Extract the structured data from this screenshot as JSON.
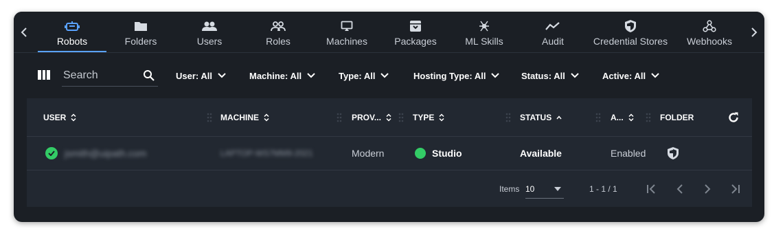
{
  "tabs": [
    {
      "label": "Robots",
      "icon": "robot-icon",
      "active": true
    },
    {
      "label": "Folders",
      "icon": "folder-icon"
    },
    {
      "label": "Users",
      "icon": "users-icon"
    },
    {
      "label": "Roles",
      "icon": "roles-icon"
    },
    {
      "label": "Machines",
      "icon": "monitor-icon"
    },
    {
      "label": "Packages",
      "icon": "package-icon"
    },
    {
      "label": "ML Skills",
      "icon": "ml-skills-icon"
    },
    {
      "label": "Audit",
      "icon": "audit-icon"
    },
    {
      "label": "Credential Stores",
      "icon": "shield-icon"
    },
    {
      "label": "Webhooks",
      "icon": "webhook-icon"
    }
  ],
  "search": {
    "placeholder": "Search"
  },
  "filters": [
    {
      "label": "User: All"
    },
    {
      "label": "Machine: All"
    },
    {
      "label": "Type: All"
    },
    {
      "label": "Hosting Type: All"
    },
    {
      "label": "Status: All"
    },
    {
      "label": "Active: All"
    }
  ],
  "table": {
    "columns": [
      "USER",
      "MACHINE",
      "PROV...",
      "TYPE",
      "STATUS",
      "A...",
      "FOLDER"
    ],
    "rows": [
      {
        "user": "jsmith@uipath.com",
        "machine": "LAPTOP-WS7MM9-2021",
        "provision": "Modern",
        "type": "Studio",
        "status": "Available",
        "active": "Enabled",
        "folder_icon": "shield-icon"
      }
    ]
  },
  "pagination": {
    "items_label": "Items",
    "page_size": "10",
    "range": "1 - 1 / 1"
  },
  "colors": {
    "accent": "#5aa2ff",
    "success": "#33cc66",
    "background": "#1b1f25",
    "table_background": "#222831"
  }
}
